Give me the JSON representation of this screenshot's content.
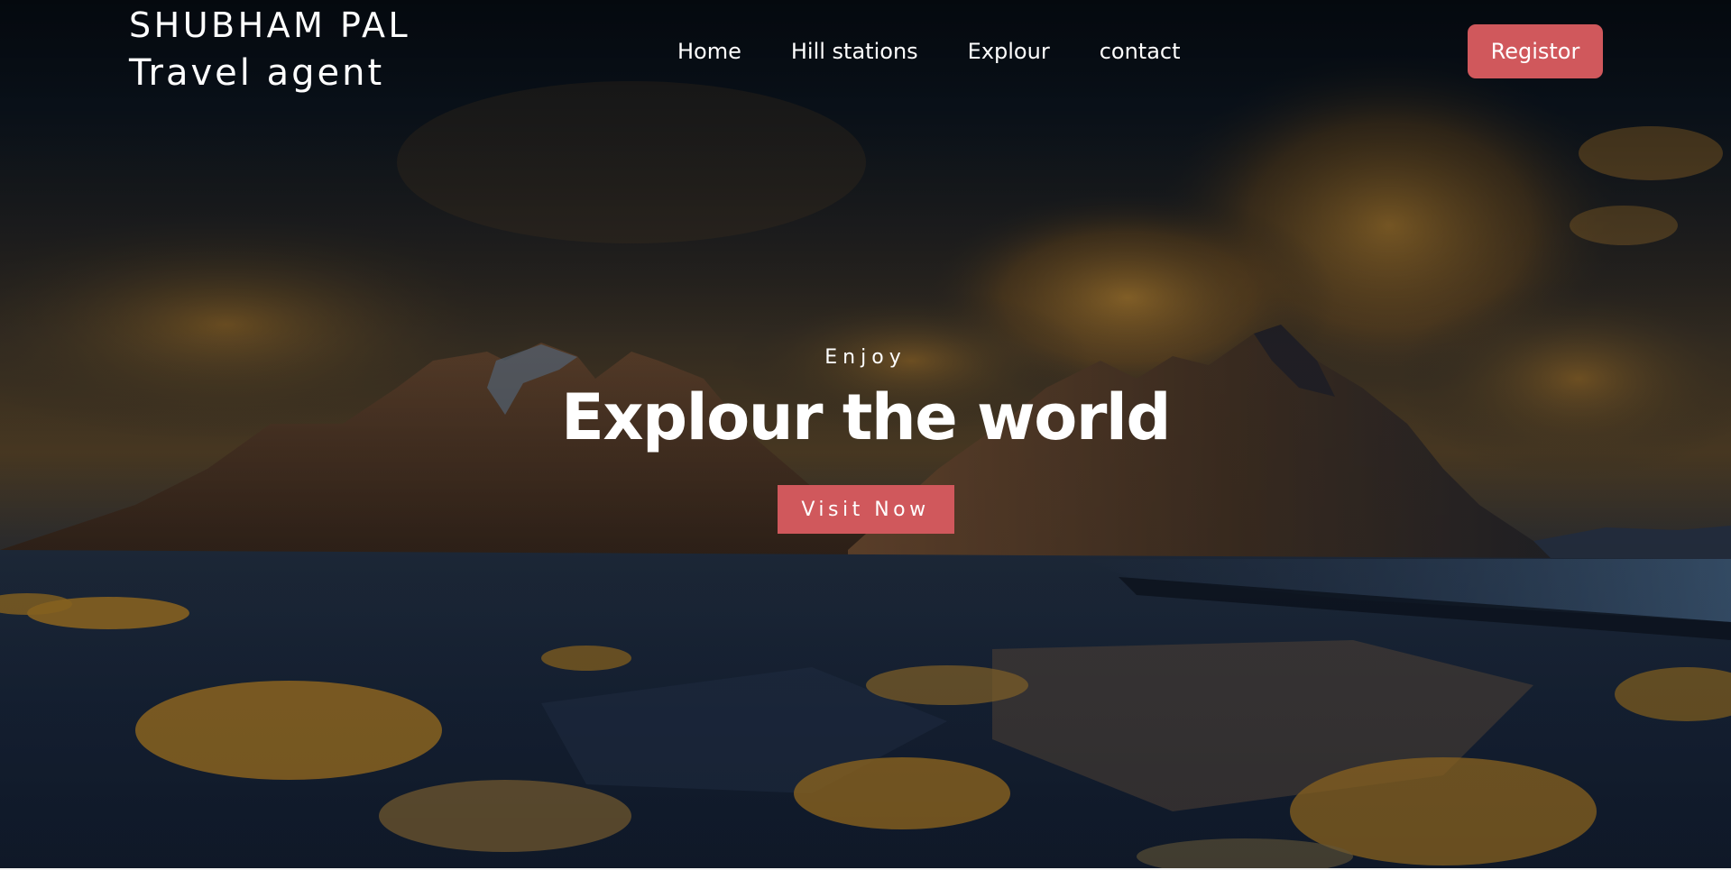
{
  "header": {
    "brand_name": "SHUBHAM PAL",
    "brand_sub": "Travel agent",
    "nav": [
      {
        "label": "Home"
      },
      {
        "label": "Hill stations"
      },
      {
        "label": "Explour"
      },
      {
        "label": "contact"
      }
    ],
    "register_label": "Registor"
  },
  "hero": {
    "kicker": "Enjoy",
    "title": "Explour the world",
    "cta_label": "Visit Now",
    "image": "mountain-landscape-background"
  },
  "colors": {
    "accent": "#d0585c",
    "text": "#ffffff",
    "overlay": "#0b1a2e"
  }
}
